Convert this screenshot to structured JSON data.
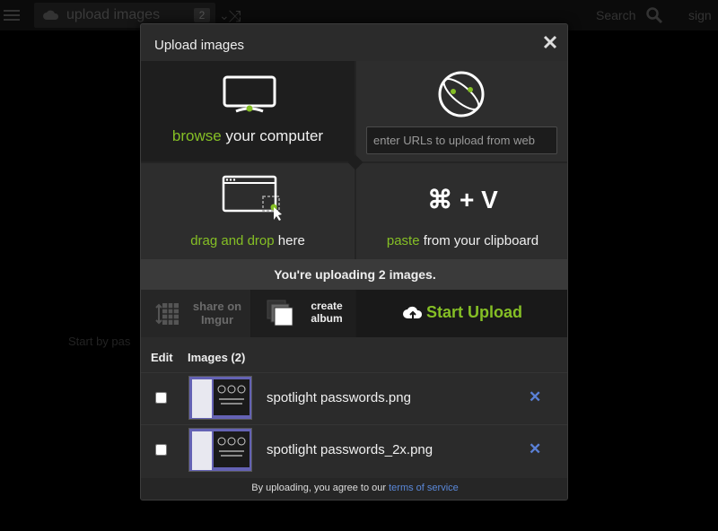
{
  "topbar": {
    "upload_label": "upload images",
    "upload_count": "2",
    "search_label": "Search",
    "sign_label": "sign"
  },
  "background_hint": "Start by pas",
  "modal": {
    "title": "Upload images",
    "browse": {
      "accent": "browse",
      "rest": " your computer"
    },
    "url": {
      "placeholder": "enter URLs to upload from web"
    },
    "drag": {
      "accent": "drag and drop",
      "rest": " here"
    },
    "paste": {
      "keys": "⌘ + V",
      "accent": "paste",
      "rest": " from your clipboard"
    },
    "status": "You're uploading 2 images.",
    "actions": {
      "share_line1": "share on",
      "share_line2": "Imgur",
      "album_line1": "create",
      "album_line2": "album",
      "start_label": "Start Upload"
    },
    "list": {
      "edit_header": "Edit",
      "images_header": "Images (2)",
      "items": [
        {
          "filename": "spotlight passwords.png"
        },
        {
          "filename": "spotlight passwords_2x.png"
        }
      ]
    },
    "footer": {
      "text": "By uploading, you agree to our ",
      "link": "terms of service"
    }
  },
  "colors": {
    "accent": "#85bf25",
    "link": "#5a88d9",
    "remove": "#5a80d6"
  },
  "icons": [
    "menu-icon",
    "cloud-upload-icon",
    "chevron-down-icon",
    "shuffle-icon",
    "search-icon",
    "close-icon",
    "monitor-icon",
    "globe-icon",
    "drag-window-icon",
    "share-grid-icon",
    "album-stack-icon",
    "remove-icon"
  ]
}
